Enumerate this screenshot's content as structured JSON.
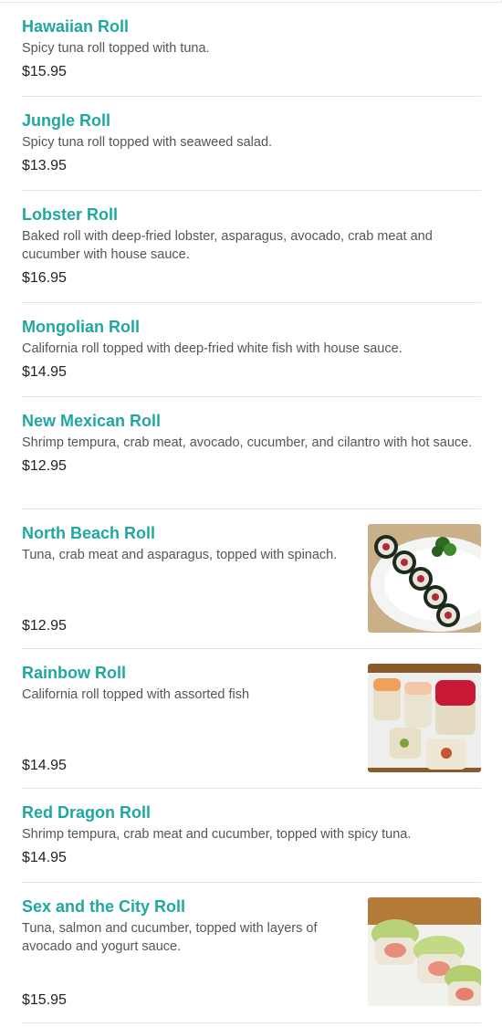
{
  "menu": {
    "items": [
      {
        "name": "Hawaiian Roll",
        "description": "Spicy tuna roll topped with tuna.",
        "price": "$15.95"
      },
      {
        "name": "Jungle Roll",
        "description": "Spicy tuna roll topped with seaweed salad.",
        "price": "$13.95"
      },
      {
        "name": "Lobster Roll",
        "description": "Baked roll with deep-fried lobster, asparagus, avocado, crab meat and cucumber with house sauce.",
        "price": "$16.95"
      },
      {
        "name": "Mongolian Roll",
        "description": "California roll topped with deep-fried white fish with house sauce.",
        "price": "$14.95"
      },
      {
        "name": "New Mexican Roll",
        "description": "Shrimp tempura, crab meat, avocado, cucumber, and cilantro with hot sauce.",
        "price": "$12.95"
      },
      {
        "name": "North Beach Roll",
        "description": "Tuna, crab meat and asparagus, topped with spinach.",
        "price": "$12.95"
      },
      {
        "name": "Rainbow Roll",
        "description": "California roll topped with assorted fish",
        "price": "$14.95"
      },
      {
        "name": "Red Dragon Roll",
        "description": "Shrimp tempura, crab meat and cucumber, topped with spicy tuna.",
        "price": "$14.95"
      },
      {
        "name": "Sex and the City Roll",
        "description": "Tuna, salmon and cucumber, topped with layers of avocado and yogurt sauce.",
        "price": "$15.95"
      }
    ]
  },
  "colors": {
    "item_name": "#20a8a0",
    "description": "#555555",
    "price": "#222222",
    "divider": "#e3e3e3"
  }
}
